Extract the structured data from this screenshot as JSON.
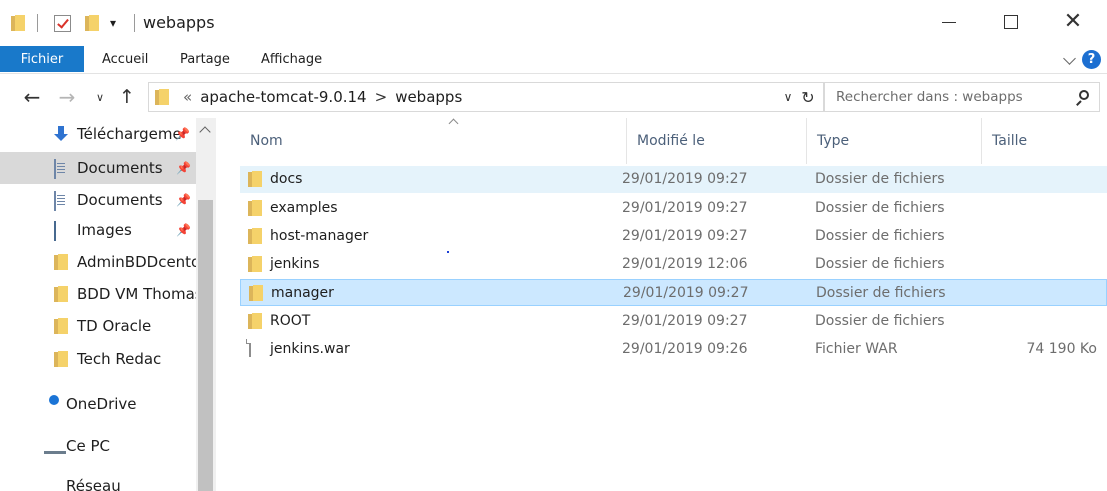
{
  "window": {
    "title": "webapps",
    "quick_access_dropdown": "▾",
    "controls": {
      "minimize": "—",
      "maximize": "☐",
      "close": "✕"
    }
  },
  "ribbon": {
    "tabs": [
      "Fichier",
      "Accueil",
      "Partage",
      "Affichage"
    ],
    "help": "?"
  },
  "address": {
    "crumb_overflow": "«",
    "crumbs": [
      "apache-tomcat-9.0.14",
      "webapps"
    ],
    "separator": ">",
    "dropdown": "∨",
    "refresh": "↻"
  },
  "search": {
    "placeholder": "Rechercher dans : webapps"
  },
  "nav_buttons": {
    "back": "←",
    "forward": "→",
    "recent": "∨",
    "up": "↑"
  },
  "nav_pane": {
    "items": [
      {
        "label": "Téléchargeme",
        "icon": "download-icon",
        "pinned": true
      },
      {
        "label": "Documents",
        "icon": "documents-icon",
        "pinned": true,
        "selected": true
      },
      {
        "label": "Documents",
        "icon": "documents-icon",
        "pinned": true
      },
      {
        "label": "Images",
        "icon": "images-icon",
        "pinned": true
      },
      {
        "label": "AdminBDDcento",
        "icon": "folder-icon",
        "pinned": false
      },
      {
        "label": "BDD VM Thomas",
        "icon": "folder-icon",
        "pinned": false
      },
      {
        "label": "TD Oracle",
        "icon": "folder-icon",
        "pinned": false
      },
      {
        "label": "Tech Redac",
        "icon": "folder-icon",
        "pinned": false
      },
      {
        "label": "OneDrive",
        "icon": "onedrive-icon",
        "pinned": false
      },
      {
        "label": "Ce PC",
        "icon": "this-pc-icon",
        "pinned": false
      },
      {
        "label": "Réseau",
        "icon": "network-icon",
        "pinned": false
      }
    ]
  },
  "file_list": {
    "columns": [
      "Nom",
      "Modifié le",
      "Type",
      "Taille"
    ],
    "rows": [
      {
        "name": "docs",
        "modified": "29/01/2019 09:27",
        "type": "Dossier de fichiers",
        "size": "",
        "kind": "folder",
        "state": "hover"
      },
      {
        "name": "examples",
        "modified": "29/01/2019 09:27",
        "type": "Dossier de fichiers",
        "size": "",
        "kind": "folder",
        "state": ""
      },
      {
        "name": "host-manager",
        "modified": "29/01/2019 09:27",
        "type": "Dossier de fichiers",
        "size": "",
        "kind": "folder",
        "state": ""
      },
      {
        "name": "jenkins",
        "modified": "29/01/2019 12:06",
        "type": "Dossier de fichiers",
        "size": "",
        "kind": "folder",
        "state": ""
      },
      {
        "name": "manager",
        "modified": "29/01/2019 09:27",
        "type": "Dossier de fichiers",
        "size": "",
        "kind": "folder",
        "state": "selected"
      },
      {
        "name": "ROOT",
        "modified": "29/01/2019 09:27",
        "type": "Dossier de fichiers",
        "size": "",
        "kind": "folder",
        "state": ""
      },
      {
        "name": "jenkins.war",
        "modified": "29/01/2019 09:26",
        "type": "Fichier WAR",
        "size": "74 190 Ko",
        "kind": "file",
        "state": ""
      }
    ]
  },
  "colors": {
    "file_tab": "#1979ca",
    "selected_row": "#cce8ff",
    "hover_row": "#e5f3fb",
    "nav_selected": "#d9d9d9",
    "folder": "#f5d26a"
  }
}
